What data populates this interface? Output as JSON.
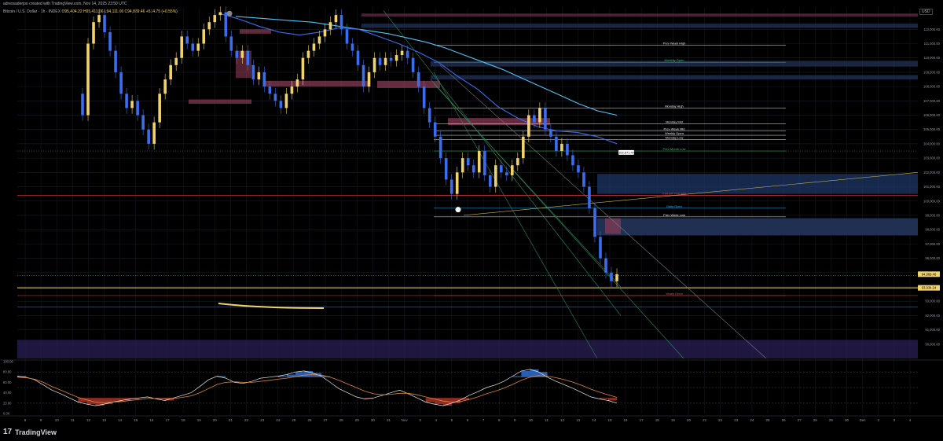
{
  "header": {
    "credit": "adressaderjoo created with TradingView.com, Nov 14, 2025 23:50 UTC",
    "symbol": "Bitcoin / U.S. Dollar · 1h · INDEX",
    "ohlc": "O95,404.22 H95,411.06 L94,111.06 C94,889.46 +514.75 (+0.55%)",
    "currency": "USD"
  },
  "footer": {
    "brand": "TradingView",
    "logo_text": "17"
  },
  "chart_data": {
    "type": "line",
    "title": "",
    "y_axis": {
      "ylim": [
        89000,
        113500
      ],
      "ticks": [
        112000,
        111000,
        110000,
        109000,
        108000,
        107000,
        106000,
        105000,
        104000,
        103000,
        102000,
        101000,
        100000,
        99000,
        98000,
        97000,
        96000,
        95000,
        94000,
        93000,
        92000,
        91000,
        90000
      ],
      "tick_labels": [
        "112,000.00",
        "111,000.00",
        "110,000.00",
        "109,000.00",
        "108,000.00",
        "107,000.00",
        "106,000.00",
        "105,000.00",
        "104,000.00",
        "103,000.00",
        "102,000.00",
        "101,000.00",
        "100,000.00",
        "99,000.00",
        "98,000.00",
        "97,000.00",
        "96,000.00",
        "95,000.00",
        "94,000.00",
        "93,000.00",
        "92,000.00",
        "91,000.00",
        "90,000.00",
        "89,000.00"
      ],
      "price_tags": [
        {
          "label": "94,889.46",
          "value": 94889,
          "color": "#f0d36a"
        },
        {
          "label": "93,934.24",
          "value": 93934,
          "color": "#f0d36a"
        }
      ]
    },
    "x_axis": {
      "labels": [
        "8",
        "9",
        "10",
        "11",
        "12",
        "13",
        "14",
        "15",
        "16",
        "17",
        "18",
        "19",
        "20",
        "21",
        "22",
        "23",
        "24",
        "25",
        "26",
        "27",
        "28",
        "29",
        "30",
        "31",
        "Nov",
        "3",
        "4",
        "5",
        "6",
        "7",
        "8",
        "9",
        "10",
        "11",
        "12",
        "13",
        "14",
        "15",
        "16",
        "17",
        "18",
        "19",
        "20",
        "21",
        "22",
        "23",
        "24",
        "25",
        "26",
        "27",
        "28",
        "29",
        "30",
        "Dec",
        "2",
        "3",
        "4"
      ]
    },
    "price_series": {
      "name": "BTCUSD",
      "values": [
        107500,
        106000,
        111000,
        112500,
        113000,
        111800,
        110500,
        109000,
        107500,
        106500,
        107000,
        106000,
        105000,
        104000,
        105500,
        107500,
        108500,
        109500,
        110000,
        111500,
        111000,
        110500,
        111000,
        112000,
        112500,
        113000,
        113200,
        111500,
        110500,
        110000,
        110500,
        109500,
        108500,
        109000,
        108000,
        107500,
        107000,
        106500,
        107500,
        108000,
        108500,
        110000,
        110500,
        111000,
        111500,
        112000,
        112500,
        113000,
        112000,
        111000,
        110500,
        109500,
        108000,
        109000,
        110000,
        109500,
        110000,
        109800,
        110200,
        110500,
        110000,
        109000,
        108000,
        106500,
        105500,
        104500,
        103000,
        101500,
        100500,
        102000,
        103000,
        102500,
        102000,
        103500,
        101800,
        101000,
        102500,
        102000,
        101800,
        102500,
        103000,
        104500,
        106000,
        105500,
        106500,
        105000,
        104500,
        103500,
        104000,
        103200,
        102500,
        102000,
        101000,
        99500,
        97500,
        96000,
        95000,
        94400,
        94889
      ]
    },
    "ema_cyan": [
      112900,
      112800,
      112700,
      112600,
      112500,
      112300,
      112100,
      111900,
      111700,
      111400,
      111100,
      110700,
      110200,
      109700,
      109200,
      108600,
      108000,
      107400,
      106800,
      106300,
      106000
    ],
    "ema_blue": [
      113100,
      112700,
      112200,
      111800,
      111600,
      111800,
      112100,
      112000,
      111500,
      111000,
      110400,
      109700,
      108700,
      107800,
      106600,
      105800,
      105200,
      104900,
      104800,
      104500,
      104000
    ],
    "oscillator": {
      "ylim": [
        0,
        100
      ],
      "tick_labels": [
        "100.00",
        "80.00",
        "60.00",
        "40.00",
        "20.00",
        "0.00"
      ],
      "ticks": [
        100,
        80,
        60,
        40,
        20,
        0
      ],
      "values": [
        72,
        70,
        65,
        55,
        45,
        38,
        30,
        22,
        18,
        15,
        18,
        22,
        25,
        28,
        30,
        32,
        28,
        25,
        30,
        35,
        40,
        52,
        65,
        72,
        68,
        60,
        58,
        62,
        68,
        70,
        72,
        75,
        80,
        82,
        78,
        72,
        60,
        48,
        40,
        32,
        28,
        30,
        35,
        40,
        45,
        38,
        30,
        22,
        18,
        15,
        20,
        26,
        35,
        42,
        50,
        55,
        62,
        72,
        82,
        85,
        80,
        70,
        62,
        55,
        48,
        40,
        32,
        28,
        25,
        20
      ],
      "signal": [
        70,
        69,
        66,
        60,
        52,
        45,
        38,
        31,
        26,
        22,
        21,
        22,
        23,
        25,
        27,
        29,
        29,
        28,
        29,
        31,
        34,
        40,
        48,
        56,
        60,
        61,
        60,
        60,
        62,
        64,
        66,
        68,
        71,
        74,
        75,
        74,
        70,
        64,
        57,
        50,
        43,
        38,
        36,
        37,
        39,
        39,
        36,
        32,
        28,
        24,
        22,
        23,
        27,
        32,
        38,
        43,
        49,
        56,
        64,
        70,
        73,
        72,
        69,
        65,
        60,
        54,
        47,
        41,
        36,
        31
      ]
    },
    "levels": [
      {
        "label": "Prev Week High",
        "value": 110900,
        "color": "#e8e8e8"
      },
      {
        "label": "Monthly Open",
        "value": 109700,
        "color": "#3fbf6f"
      },
      {
        "label": "Monday High",
        "value": 106500,
        "color": "#e8e8e8"
      },
      {
        "label": "Monday Mid",
        "value": 105400,
        "color": "#e8e8e8"
      },
      {
        "label": "Prev Week Mid",
        "value": 104900,
        "color": "#e8e8e8"
      },
      {
        "label": "Weekly Open",
        "value": 104600,
        "color": "#e8e8e8"
      },
      {
        "label": "Monday Low",
        "value": 104300,
        "color": "#e8e8e8"
      },
      {
        "label": "Prev Month Low",
        "value": 103500,
        "color": "#3fbf6f"
      },
      {
        "label": "Current Year Mid",
        "value": 100400,
        "color": "#e05050"
      },
      {
        "label": "Daily Open",
        "value": 99500,
        "color": "#29b6f6"
      },
      {
        "label": "Prev Week Low",
        "value": 98900,
        "color": "#e8e8e8"
      },
      {
        "label": "Yearly Open",
        "value": 93400,
        "color": "#e05050"
      }
    ],
    "marker_label": "103,671.40"
  }
}
